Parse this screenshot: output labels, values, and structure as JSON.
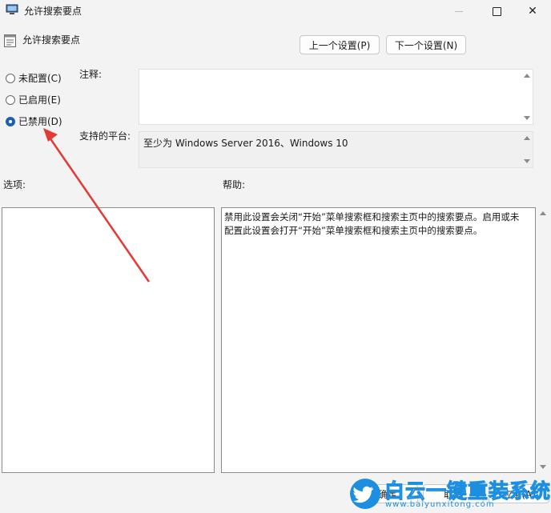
{
  "window": {
    "title": "允许搜索要点"
  },
  "header": {
    "policy_name": "允许搜索要点",
    "prev_label": "上一个设置(P)",
    "next_label": "下一个设置(N)"
  },
  "state": {
    "options": [
      {
        "label": "未配置(C)",
        "checked": false
      },
      {
        "label": "已启用(E)",
        "checked": false
      },
      {
        "label": "已禁用(D)",
        "checked": true
      }
    ]
  },
  "labels": {
    "comment": "注释:",
    "platform": "支持的平台:",
    "options": "选项:",
    "help": "帮助:"
  },
  "platform_text": "至少为 Windows Server 2016、Windows 10",
  "help_text": "禁用此设置会关闭“开始”菜单搜索框和搜索主页中的搜索要点。启用或未配置此设置会打开“开始”菜单搜索框和搜索主页中的搜索要点。",
  "footer": {
    "ok": "确定",
    "cancel": "取消",
    "apply": "应用(A)"
  },
  "watermark": {
    "text": "白云一键重装系统",
    "url": "www.baiyunxitong.com"
  },
  "colors": {
    "radio_accent": "#1f5fb3",
    "annotation_arrow": "#e53935",
    "watermark": "#1d8fe0"
  }
}
